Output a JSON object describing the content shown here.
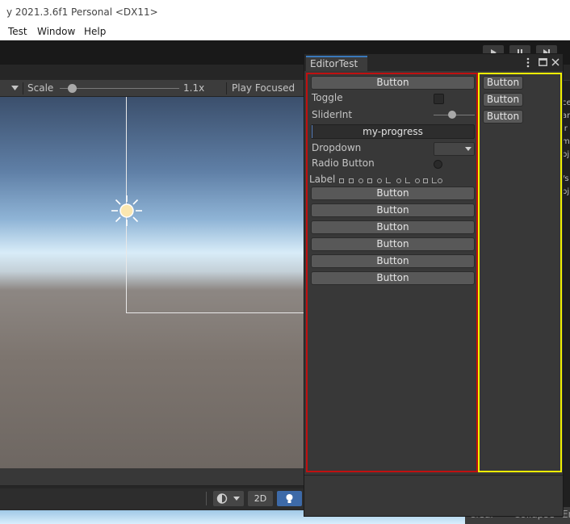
{
  "window": {
    "title": "y 2021.3.6f1 Personal <DX11>"
  },
  "menu": {
    "items": [
      "Test",
      "Window",
      "Help"
    ]
  },
  "toolbar": {
    "play_icons": [
      "play-icon",
      "pause-icon",
      "step-icon"
    ]
  },
  "game_toolbar": {
    "scale_label": "Scale",
    "scale_value": "1.1x",
    "scale_level": 0.07,
    "play_focused_label": "Play Focused"
  },
  "editor_window": {
    "tab_title": "EditorTest",
    "left": {
      "top_button": "Button",
      "toggle_label": "Toggle",
      "slider_label": "SliderInt",
      "slider_level": 0.43,
      "progress_title": "my-progress",
      "dropdown_label": "Dropdown",
      "radio_label": "Radio Button",
      "label_text": "Label",
      "buttons": [
        "Button",
        "Button",
        "Button",
        "Button",
        "Button",
        "Button"
      ]
    },
    "right": {
      "buttons": [
        "Button",
        "Button",
        "Button"
      ]
    }
  },
  "scene_controls": {
    "two_d_label": "2D"
  },
  "console": {
    "clear_label": "Clear",
    "collapse_label": "Collapse",
    "error_pause_label": "Er",
    "side_text": [
      "ce",
      "ar",
      "ir",
      "m",
      "bj",
      "/s",
      "bj"
    ]
  },
  "colors": {
    "left_panel_border": "#c01010",
    "right_panel_border": "#f2f200",
    "tab_accent": "#3a79bb",
    "light_button": "#3d6aa8"
  }
}
